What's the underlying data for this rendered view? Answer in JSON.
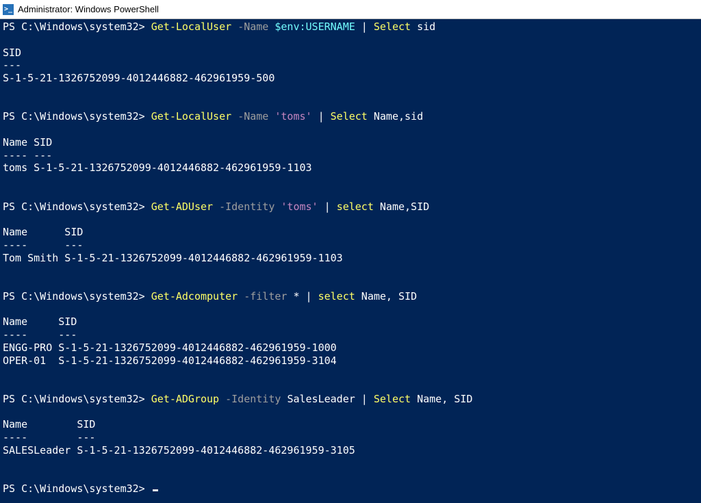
{
  "window": {
    "title": "Administrator: Windows PowerShell",
    "icon_glyph": ">_"
  },
  "prompt": "PS C:\\Windows\\system32> ",
  "commands": [
    {
      "cmdlet": "Get-LocalUser",
      "param": "-Name",
      "arg_var": "$env:USERNAME",
      "pipe": " | ",
      "cmdlet2": "Select",
      "tail": " sid"
    },
    {
      "cmdlet": "Get-LocalUser",
      "param": "-Name",
      "arg_str": "'toms'",
      "pipe": " | ",
      "cmdlet2": "Select",
      "tail": " Name,sid"
    },
    {
      "cmdlet": "Get-ADUser",
      "param": "-Identity",
      "arg_str": "'toms'",
      "pipe": " | ",
      "cmdlet2": "select",
      "tail": " Name,SID"
    },
    {
      "cmdlet": "Get-Adcomputer",
      "param": "-filter",
      "arg_plain": "*",
      "pipe": " | ",
      "cmdlet2": "select",
      "tail": " Name, SID"
    },
    {
      "cmdlet": "Get-ADGroup",
      "param": "-Identity",
      "arg_plain": "SalesLeader",
      "pipe": " | ",
      "cmdlet2": "Select",
      "tail": " Name, SID"
    }
  ],
  "outputs": {
    "o1": {
      "header": "SID",
      "header_rule": "---",
      "row": "S-1-5-21-1326752099-4012446882-462961959-500"
    },
    "o2": {
      "header": "Name SID",
      "header_rule": "---- ---",
      "row": "toms S-1-5-21-1326752099-4012446882-462961959-1103"
    },
    "o3": {
      "header": "Name      SID",
      "header_rule": "----      ---",
      "row": "Tom Smith S-1-5-21-1326752099-4012446882-462961959-1103"
    },
    "o4": {
      "header": "Name     SID",
      "header_rule": "----     ---",
      "row1": "ENGG-PRO S-1-5-21-1326752099-4012446882-462961959-1000",
      "row2": "OPER-01  S-1-5-21-1326752099-4012446882-462961959-3104"
    },
    "o5": {
      "header": "Name        SID",
      "header_rule": "----        ---",
      "row": "SALESLeader S-1-5-21-1326752099-4012446882-462961959-3105"
    }
  }
}
